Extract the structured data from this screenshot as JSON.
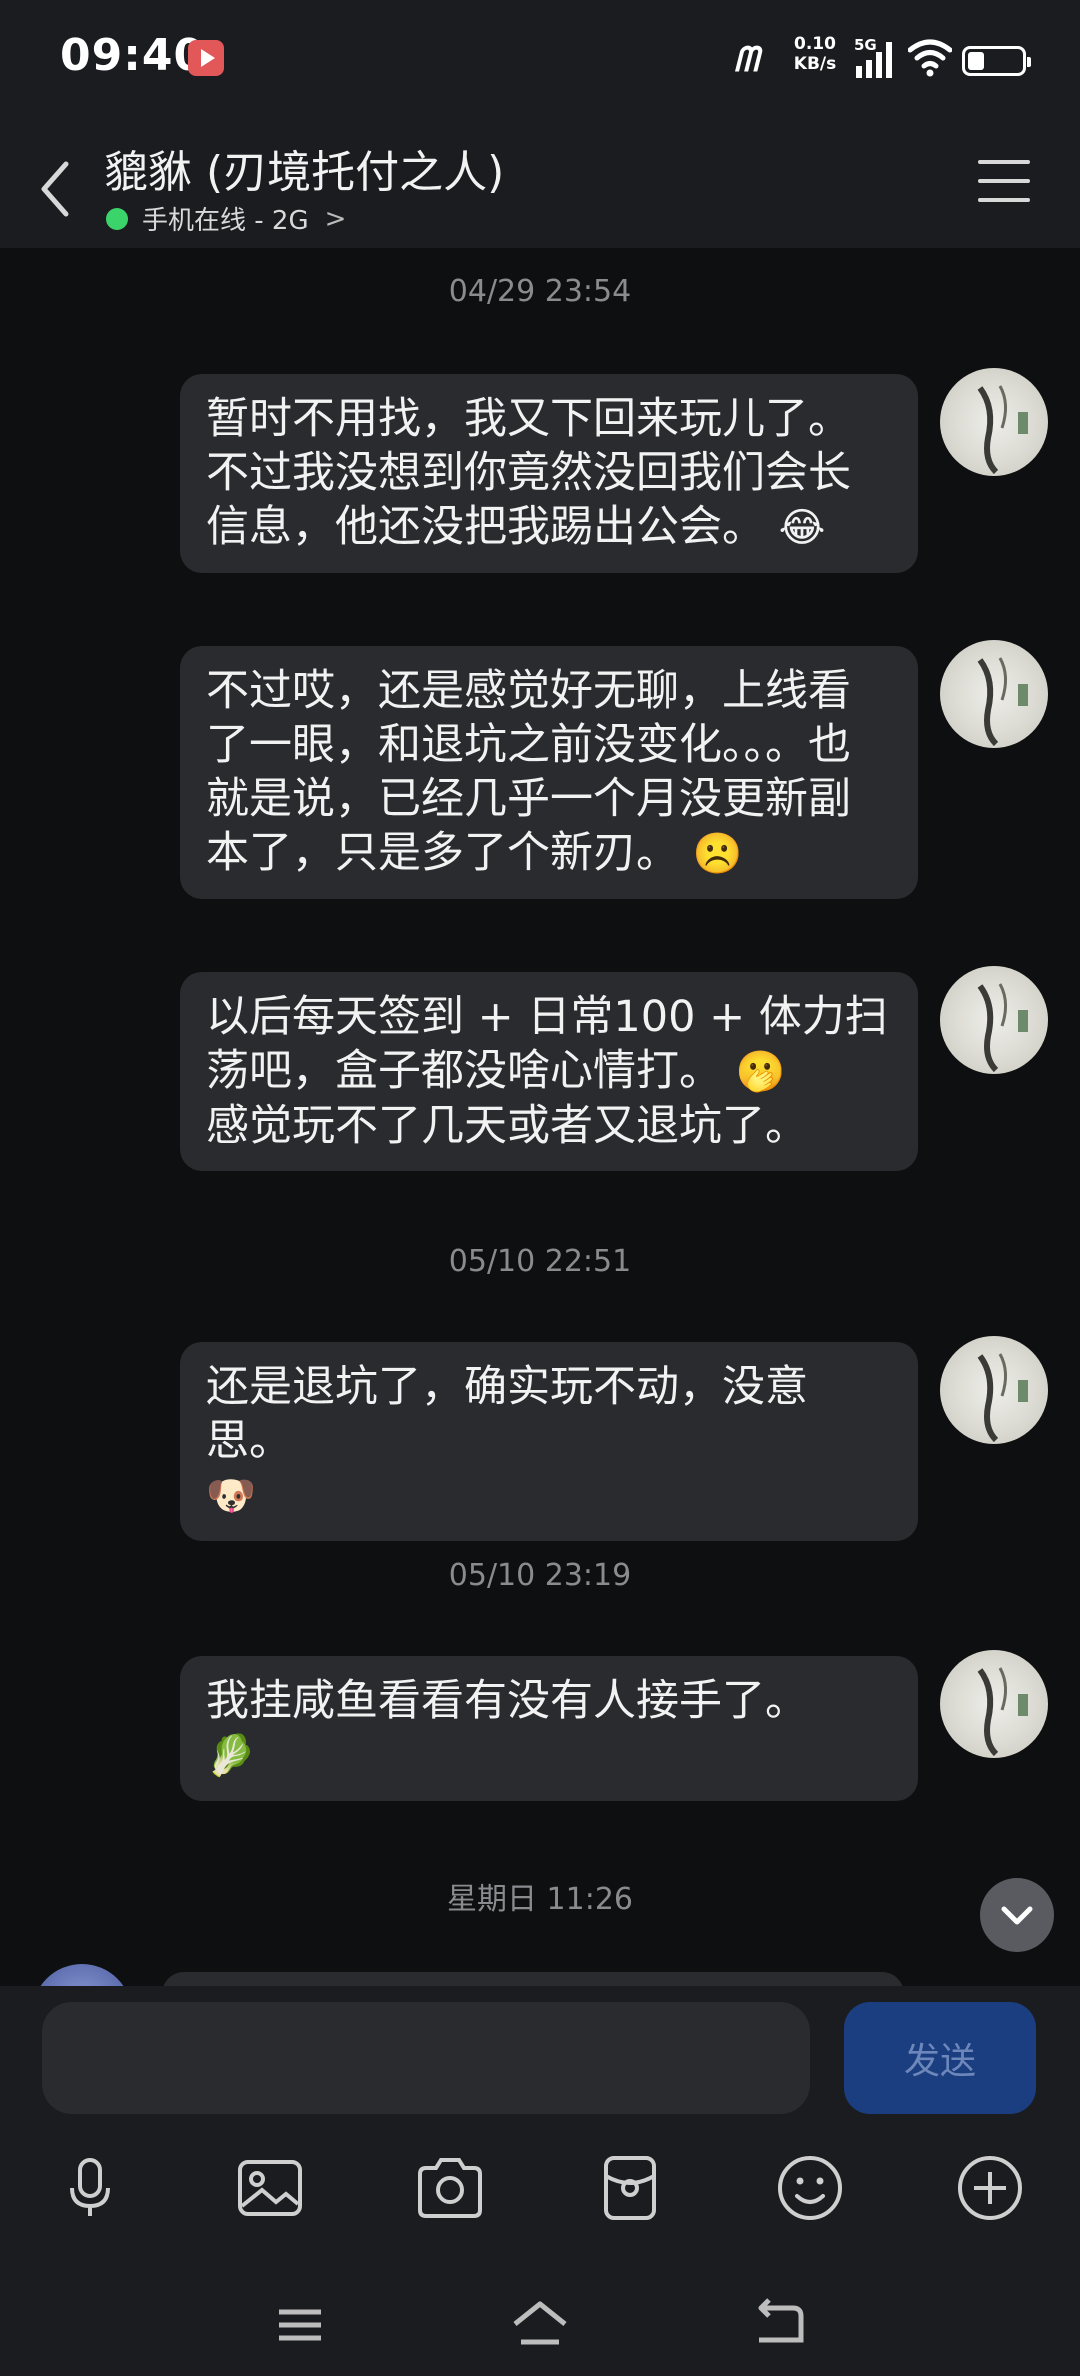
{
  "status_bar": {
    "time": "09:40",
    "net_speed_value": "0.10",
    "net_speed_unit": "KB/s",
    "network_type": "5G",
    "icons": [
      "screen-record-icon",
      "mm-carrier-icon",
      "signal-icon",
      "wifi-icon",
      "battery-icon"
    ]
  },
  "header": {
    "contact_name": "貔貅 (刃境托付之人)",
    "status": "手机在线 - 2G",
    "status_chevron": ">",
    "status_color": "#3bd46a"
  },
  "messages": [
    {
      "timestamp": "04/29 23:54",
      "text": "暂时不用找，我又下回来玩儿了。不过我没想到你竟然没回我们会长信息，他还没把我踢出公会。",
      "emoji": "😂"
    },
    {
      "text": "不过哎，还是感觉好无聊，上线看了一眼，和退坑之前没变化。。。也就是说，已经几乎一个月没更新副本了，只是多了个新刃。",
      "emoji": "☹️"
    },
    {
      "text_line1": "以后每天签到 + 日常100 + 体力扫荡吧，盒子都没啥心情打。",
      "emoji": "🫢",
      "text_line2": "感觉玩不了几天或者又退坑了。"
    },
    {
      "timestamp": "05/10 22:51",
      "text": "还是退坑了，确实玩不动，没意思。",
      "emoji": "🐶"
    },
    {
      "timestamp": "05/10 23:19",
      "text": "我挂咸鱼看看有没有人接手了。",
      "emoji": "🥬"
    },
    {
      "timestamp": "星期日 11:26"
    }
  ],
  "input": {
    "value": "",
    "placeholder": "",
    "send_label": "发送"
  },
  "toolbar_icons": [
    "microphone-icon",
    "image-icon",
    "camera-icon",
    "red-packet-icon",
    "emoji-icon",
    "plus-icon"
  ],
  "nav_icons": [
    "menu-icon",
    "home-icon",
    "back-icon"
  ],
  "colors": {
    "background": "#0e0f11",
    "bubble": "#2a2b2f",
    "send_button": "#1b3e80"
  }
}
